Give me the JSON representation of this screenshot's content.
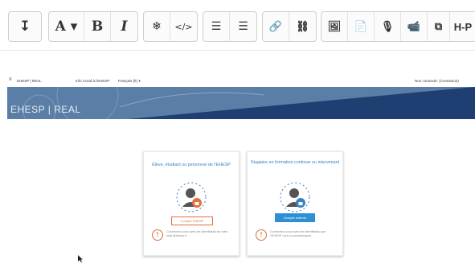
{
  "toolbar": {
    "buttons": [
      {
        "name": "indent-button",
        "label": "↧"
      },
      {
        "name": "text-color-button",
        "label": "A ▾"
      },
      {
        "name": "bold-button",
        "label": "B"
      },
      {
        "name": "italic-button",
        "label": "I"
      },
      {
        "name": "special-chars-button",
        "label": "❄"
      },
      {
        "name": "source-code-button",
        "label": "</>"
      },
      {
        "name": "bullet-list-button",
        "label": "☰"
      },
      {
        "name": "numbered-list-button",
        "label": "☰"
      },
      {
        "name": "link-button",
        "label": "🔗"
      },
      {
        "name": "unlink-button",
        "label": "⛓"
      },
      {
        "name": "image-button",
        "label": "🖼"
      },
      {
        "name": "file-button",
        "label": "📄"
      },
      {
        "name": "audio-button",
        "label": "🎙"
      },
      {
        "name": "video-button",
        "label": "📹"
      },
      {
        "name": "copy-button",
        "label": "⧉"
      },
      {
        "name": "h5p-button",
        "label": "H-P"
      }
    ]
  },
  "embedded": {
    "nav": {
      "menu_label": "≡",
      "site": "EHESP | REAL",
      "info_link": "Info Covid à l'EHESP",
      "language": "Français (fr) ▾",
      "login_status": "Non connecté. (Connexion)"
    },
    "banner": {
      "title": "EHESP | REAL",
      "color": "#5a7ea6"
    },
    "cards": [
      {
        "title": "Élève, étudiant ou personnel de l'EHESP",
        "button": "Compte EHESP",
        "note": "Connectez-vous avec les identifiants de votre mail @ehesp.fr",
        "accent": "#e07040"
      },
      {
        "title": "Stagiaire en formation continue ou intervenant",
        "button": "Compte externe",
        "note": "Connectez-vous avec les identifiants que l'EHESP vous a communiqués",
        "accent": "#3b82c4"
      }
    ]
  }
}
